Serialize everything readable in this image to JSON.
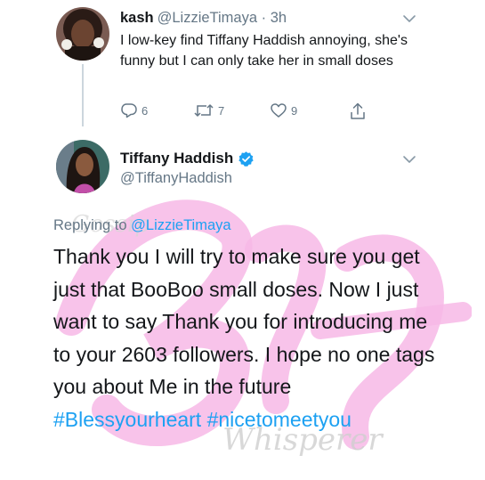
{
  "reply_tweet": {
    "name": "kash",
    "handle": "@LizzieTimaya",
    "separator": "·",
    "time": "3h",
    "text": "I low-key find Tiffany Haddish annoying, she's funny but I can only take her in small doses",
    "actions": {
      "reply_count": "6",
      "retweet_count": "7",
      "like_count": "9"
    }
  },
  "main_tweet": {
    "name": "Tiffany Haddish",
    "handle": "@TiffanyHaddish",
    "replying_prefix": "Replying to",
    "replying_to": "@LizzieTimaya",
    "text": "Thank you I will try to make sure you get just that BooBoo small doses. Now I just want to say Thank you for introducing me to your  2603 followers. I hope no one tags you about Me in the future",
    "hashtag_1": "#Blessyourheart",
    "hashtag_2": "#nicetomeetyou"
  },
  "watermark": {
    "word_1": "Gossip",
    "word_2": "Whisperer"
  },
  "colors": {
    "link": "#1da1f2",
    "secondary_text": "#657786",
    "primary_text": "#14171a",
    "watermark_pink": "#f7b8e6",
    "watermark_gray": "#c9c9c9"
  },
  "icons": {
    "reply": "comment-icon",
    "retweet": "retweet-icon",
    "like": "heart-icon",
    "share": "share-icon",
    "menu": "chevron-down-icon",
    "verified": "verified-badge-icon"
  }
}
